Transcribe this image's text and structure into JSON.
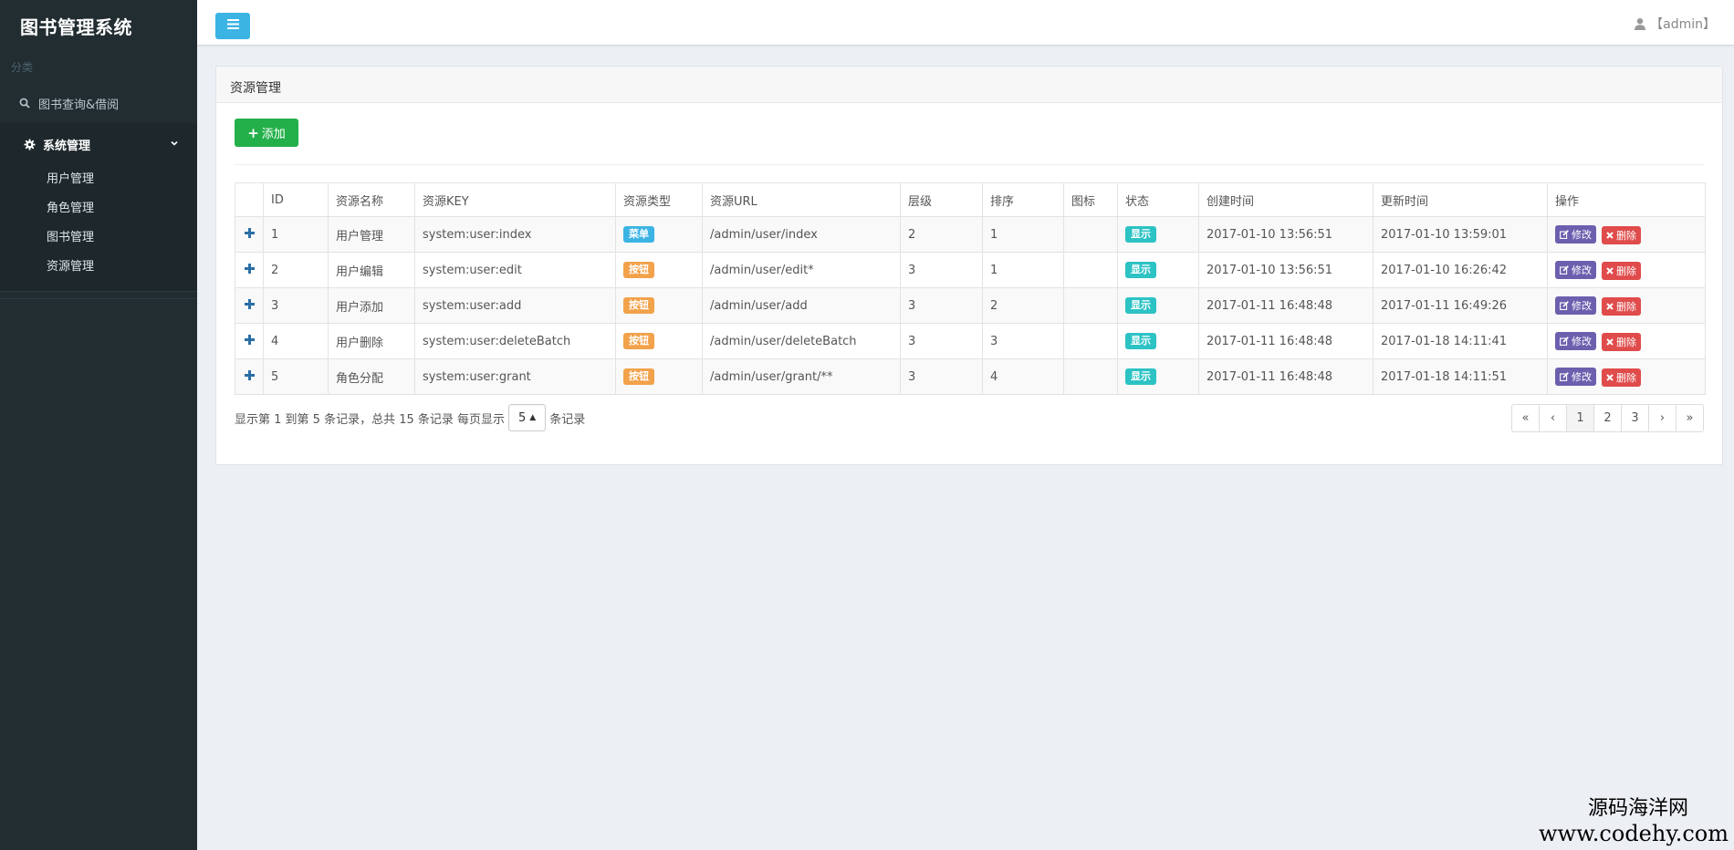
{
  "sidebar": {
    "brand": "图书管理系统",
    "header": "分类",
    "items": [
      {
        "label": "图书查询&借阅",
        "icon": "search-icon"
      }
    ],
    "open_menu": {
      "label": "系统管理",
      "icon": "gear-icon",
      "subitems": [
        "用户管理",
        "角色管理",
        "图书管理",
        "资源管理"
      ]
    }
  },
  "header": {
    "user_label": "【admin】"
  },
  "box": {
    "title": "资源管理",
    "add_label": "添加"
  },
  "table": {
    "columns": [
      "ID",
      "资源名称",
      "资源KEY",
      "资源类型",
      "资源URL",
      "层级",
      "排序",
      "图标",
      "状态",
      "创建时间",
      "更新时间",
      "操作"
    ],
    "rows": [
      {
        "id": "1",
        "name": "用户管理",
        "key": "system:user:index",
        "type": "菜单",
        "url": "/admin/user/index",
        "level": "2",
        "order": "1",
        "icon": "",
        "status": "显示",
        "created": "2017-01-10 13:56:51",
        "updated": "2017-01-10 13:59:01"
      },
      {
        "id": "2",
        "name": "用户编辑",
        "key": "system:user:edit",
        "type": "按钮",
        "url": "/admin/user/edit*",
        "level": "3",
        "order": "1",
        "icon": "",
        "status": "显示",
        "created": "2017-01-10 13:56:51",
        "updated": "2017-01-10 16:26:42"
      },
      {
        "id": "3",
        "name": "用户添加",
        "key": "system:user:add",
        "type": "按钮",
        "url": "/admin/user/add",
        "level": "3",
        "order": "2",
        "icon": "",
        "status": "显示",
        "created": "2017-01-11 16:48:48",
        "updated": "2017-01-11 16:49:26"
      },
      {
        "id": "4",
        "name": "用户删除",
        "key": "system:user:deleteBatch",
        "type": "按钮",
        "url": "/admin/user/deleteBatch",
        "level": "3",
        "order": "3",
        "icon": "",
        "status": "显示",
        "created": "2017-01-11 16:48:48",
        "updated": "2017-01-18 14:11:41"
      },
      {
        "id": "5",
        "name": "角色分配",
        "key": "system:user:grant",
        "type": "按钮",
        "url": "/admin/user/grant/**",
        "level": "3",
        "order": "4",
        "icon": "",
        "status": "显示",
        "created": "2017-01-11 16:48:48",
        "updated": "2017-01-18 14:11:51"
      }
    ],
    "edit_label": "修改",
    "delete_label": "删除"
  },
  "footer": {
    "info_prefix": "显示第 1 到第 5 条记录，总共 15 条记录 每页显示",
    "page_size": "5",
    "info_suffix": "条记录"
  },
  "pagination": {
    "first": "«",
    "prev": "‹",
    "pages": [
      "1",
      "2",
      "3"
    ],
    "active": "1",
    "next": "›",
    "last": "»"
  },
  "watermark": {
    "line1": "源码海洋网",
    "line2": "www.codehy.com"
  },
  "colors": {
    "sidebar_bg": "#222d32",
    "accent": "#3bb4e4",
    "add_green": "#23b04a",
    "badge_menu": "#3bb4e4",
    "badge_button": "#f2a24b",
    "badge_show": "#2dc3c5",
    "edit_purple": "#6c5fae",
    "delete_red": "#e04b4b"
  }
}
